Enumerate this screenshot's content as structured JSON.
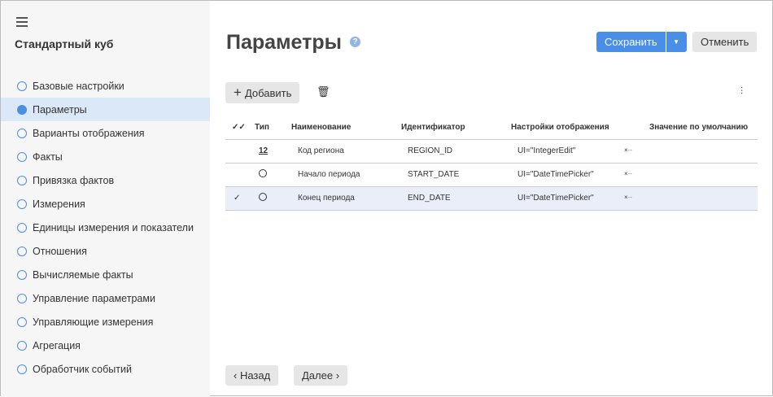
{
  "sidebar": {
    "title": "Стандартный куб",
    "items": [
      {
        "label": "Базовые настройки"
      },
      {
        "label": "Параметры",
        "active": true
      },
      {
        "label": "Варианты отображения"
      },
      {
        "label": "Факты"
      },
      {
        "label": "Привязка фактов"
      },
      {
        "label": "Измерения"
      },
      {
        "label": "Единицы измерения и показатели"
      },
      {
        "label": "Отношения"
      },
      {
        "label": "Вычисляемые факты"
      },
      {
        "label": "Управление параметрами"
      },
      {
        "label": "Управляющие измерения"
      },
      {
        "label": "Агрегация"
      },
      {
        "label": "Обработчик событий"
      }
    ]
  },
  "header": {
    "title": "Параметры",
    "help": "?",
    "save": "Сохранить",
    "cancel": "Отменить"
  },
  "toolbar": {
    "add": "Добавить"
  },
  "table": {
    "headers": [
      "Тип",
      "Наименование",
      "Идентификатор",
      "Настройки отображения",
      "Значение по умолчанию"
    ],
    "rows": [
      {
        "type": "12",
        "name": "Код региона",
        "id": "REGION_ID",
        "ui": "UI=\"IntegerEdit\"",
        "more": "×··",
        "selected": false
      },
      {
        "type": "clock",
        "name": "Начало периода",
        "id": "START_DATE",
        "ui": "UI=\"DateTimePicker\"",
        "more": "×··",
        "selected": false
      },
      {
        "type": "clock",
        "name": "Конец периода",
        "id": "END_DATE",
        "ui": "UI=\"DateTimePicker\"",
        "more": "×··",
        "selected": true
      }
    ]
  },
  "footer": {
    "back": "Назад",
    "next": "Далее"
  }
}
